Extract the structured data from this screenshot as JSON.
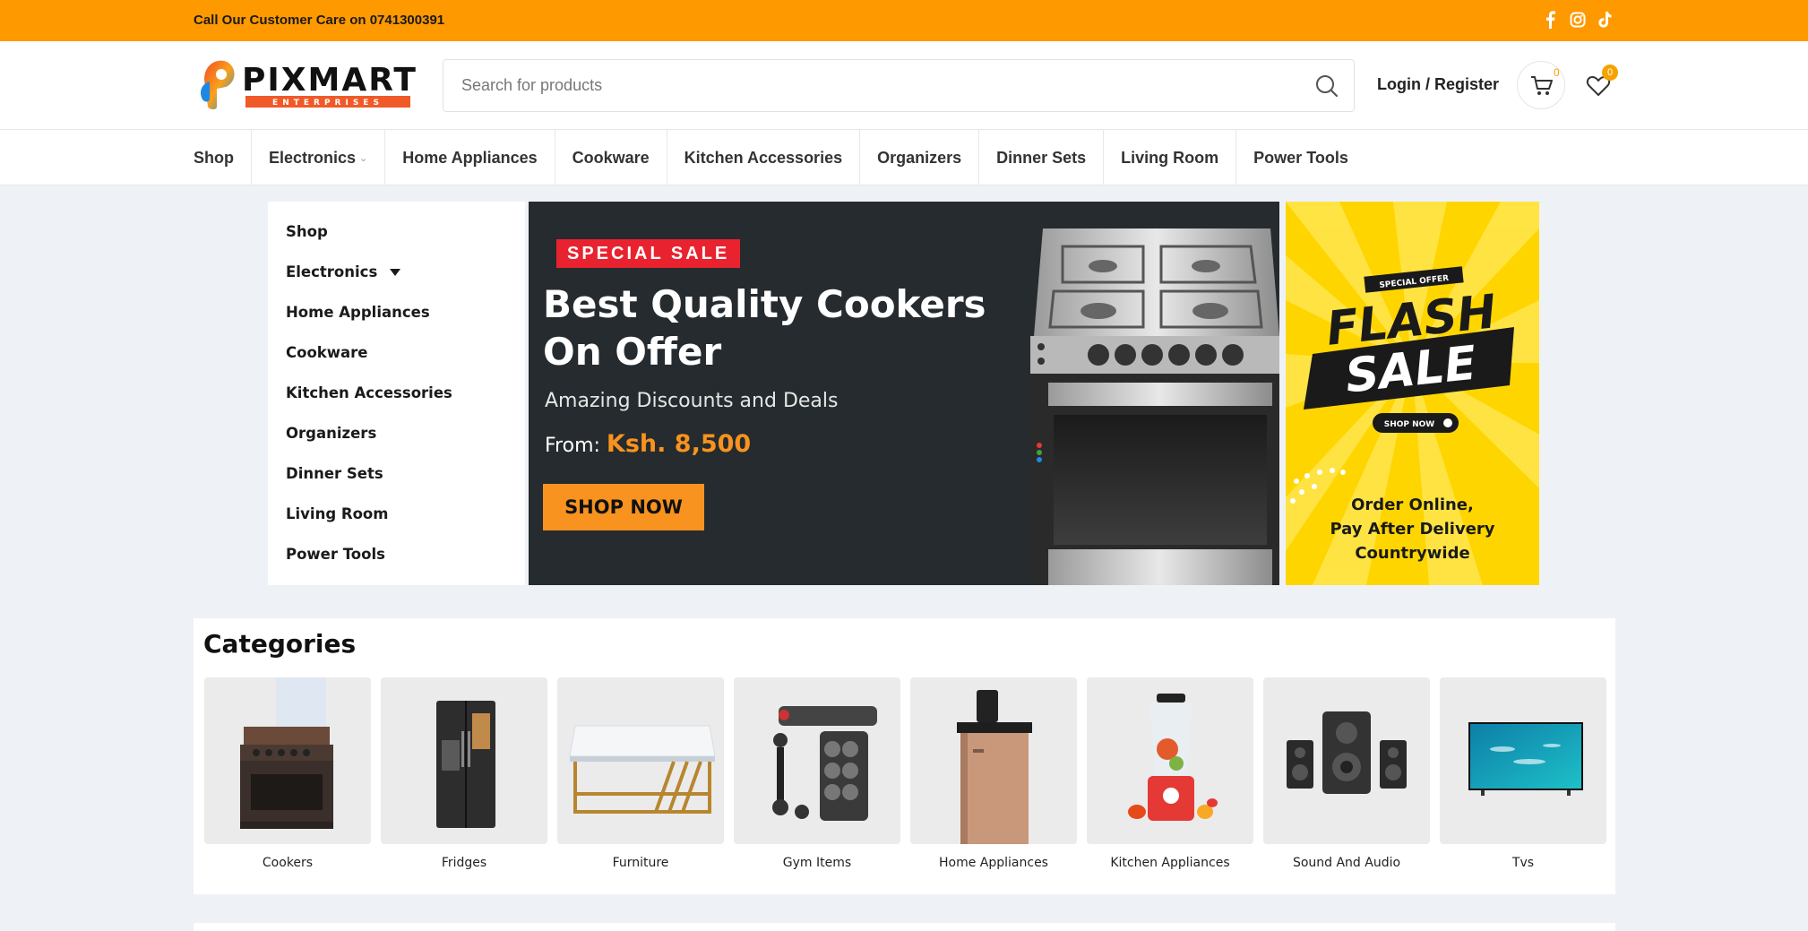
{
  "topbar": {
    "customer_care": "Call Our Customer Care on 0741300391",
    "socials": [
      "facebook-icon",
      "instagram-icon",
      "tiktok-icon"
    ],
    "background": "#ff9900"
  },
  "header": {
    "logo_name": "PIXMART",
    "logo_sub": "ENTERPRISES",
    "search_placeholder": "Search for products",
    "login_label": "Login / Register",
    "cart_count": "0",
    "wishlist_count": "0"
  },
  "nav": {
    "items": [
      {
        "label": "Shop"
      },
      {
        "label": "Electronics",
        "has_dropdown": true
      },
      {
        "label": "Home Appliances"
      },
      {
        "label": "Cookware"
      },
      {
        "label": "Kitchen Accessories"
      },
      {
        "label": "Organizers"
      },
      {
        "label": "Dinner Sets"
      },
      {
        "label": "Living Room"
      },
      {
        "label": "Power Tools"
      }
    ]
  },
  "sidebar": {
    "items": [
      {
        "label": "Shop"
      },
      {
        "label": "Electronics",
        "has_dropdown": true
      },
      {
        "label": "Home Appliances"
      },
      {
        "label": "Cookware"
      },
      {
        "label": "Kitchen Accessories"
      },
      {
        "label": "Organizers"
      },
      {
        "label": "Dinner Sets"
      },
      {
        "label": "Living Room"
      },
      {
        "label": "Power Tools"
      }
    ]
  },
  "hero": {
    "tag": "SPECIAL SALE",
    "title_line1": "Best Quality Cookers",
    "title_line2": "On Offer",
    "subtitle": "Amazing Discounts and Deals",
    "price_prefix": "From:",
    "price": "Ksh. 8,500",
    "button": "SHOP NOW"
  },
  "flash": {
    "special_offer": "SPECIAL OFFER",
    "flash": "FLASH",
    "sale": "SALE",
    "shop_now": "SHOP NOW",
    "line1": "Order Online,",
    "line2": "Pay After Delivery",
    "line3": "Countrywide"
  },
  "categories": {
    "title": "Categories",
    "items": [
      {
        "label": "Cookers"
      },
      {
        "label": "Fridges"
      },
      {
        "label": "Furniture"
      },
      {
        "label": "Gym Items"
      },
      {
        "label": "Home Appliances"
      },
      {
        "label": "Kitchen Appliances"
      },
      {
        "label": "Sound And Audio"
      },
      {
        "label": "Tvs"
      }
    ]
  }
}
